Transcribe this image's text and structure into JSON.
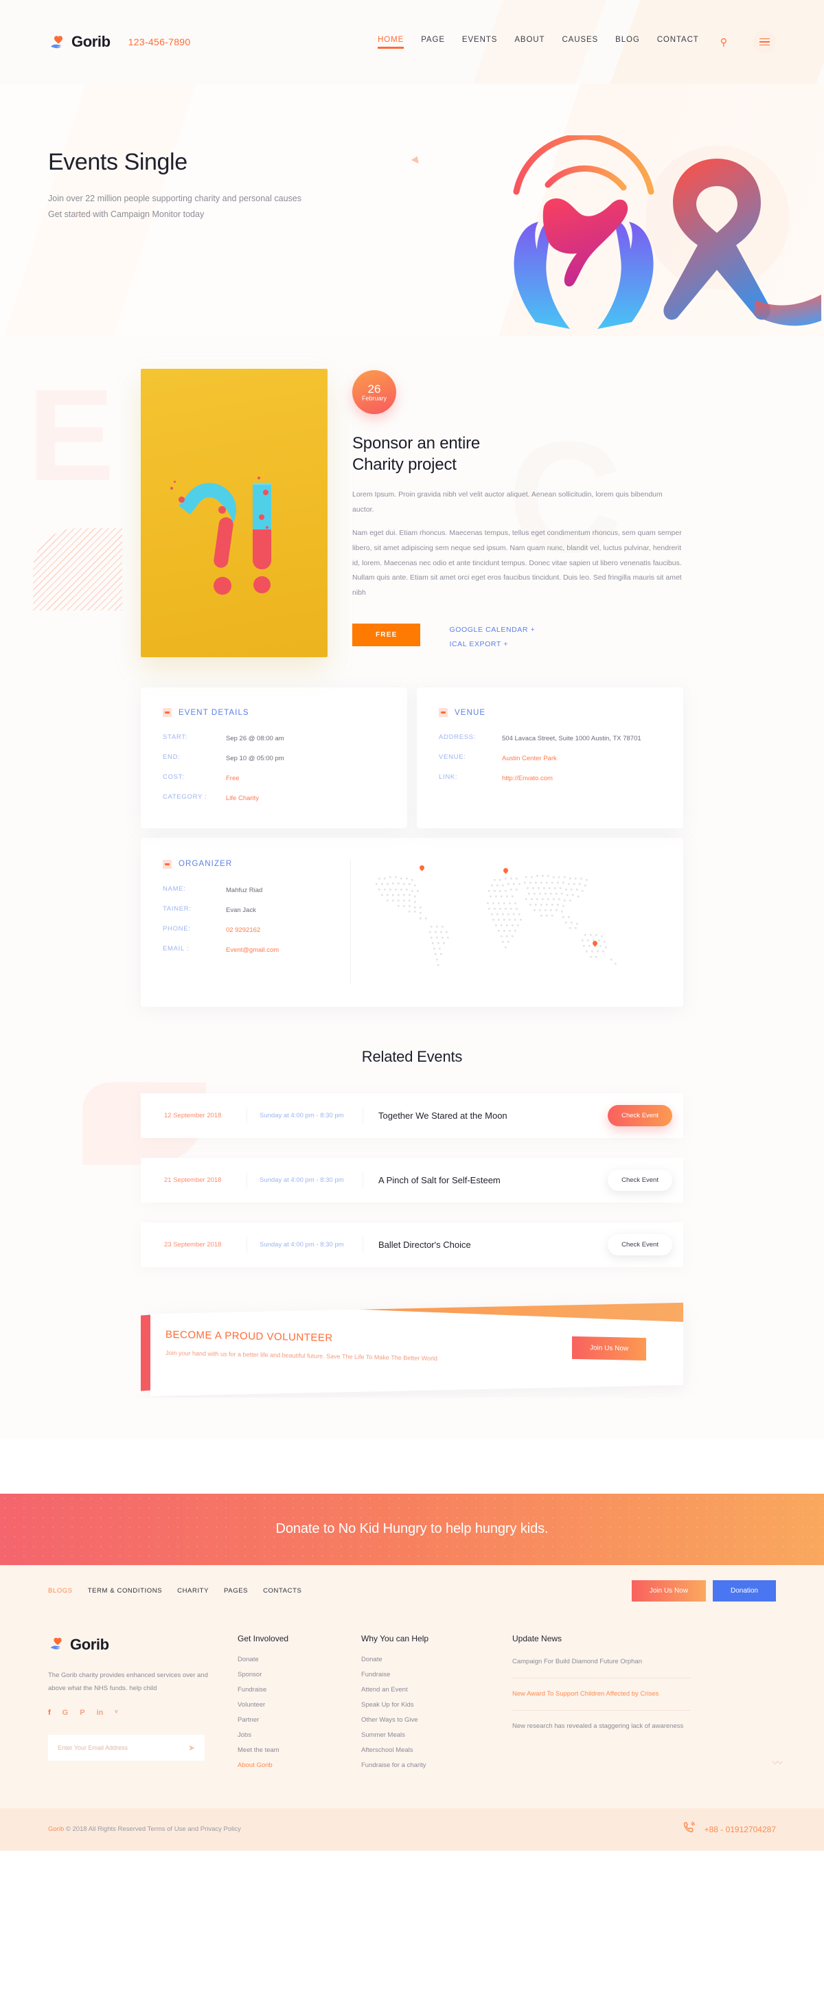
{
  "header": {
    "brand": "Gorib",
    "logo_icon": "heart-hand-icon",
    "phone": "123-456-7890",
    "nav": [
      {
        "label": "HOME",
        "active": true
      },
      {
        "label": "PAGE",
        "active": false
      },
      {
        "label": "EVENTS",
        "active": false
      },
      {
        "label": "ABOUT",
        "active": false
      },
      {
        "label": "CAUSES",
        "active": false
      },
      {
        "label": "BLOG",
        "active": false
      },
      {
        "label": "CONTACT",
        "active": false
      }
    ],
    "search_icon": "search-icon",
    "menu_icon": "hamburger-icon"
  },
  "hero": {
    "title": "Events Single",
    "subtitle_line1": "Join over 22 million people supporting charity and personal causes",
    "subtitle_line2": "Get started with Campaign Monitor today",
    "illustration": "hands-dove-ribbon-icon"
  },
  "event": {
    "image_alt": "question-exclamation-mark-photo",
    "date_day": "26",
    "date_month": "February",
    "title_line1": "Sponsor an entire",
    "title_line2": "Charity project",
    "paragraph1": "Lorem Ipsum. Proin gravida nibh vel velit auctor aliquet. Aenean sollicitudin, lorem quis bibendum auctor.",
    "paragraph2": "Nam eget dui. Etiam rhoncus. Maecenas tempus, tellus eget condimentum rhoncus, sem quam semper libero, sit amet adipiscing sem neque sed ipsum. Nam quam nunc, blandit vel, luctus pulvinar, hendrerit id, lorem. Maecenas nec odio et ante tincidunt tempus. Donec vitae sapien ut libero venenatis faucibus. Nullam quis ante. Etiam sit amet orci eget eros faucibus tincidunt. Duis leo. Sed fringilla mauris sit amet nibh",
    "price_button": "FREE",
    "google_calendar": "GOOGLE CALENDAR +",
    "ical_export": "ICAL EXPORT +"
  },
  "event_details": {
    "title": "EVENT DETAILS",
    "rows": [
      {
        "label": "START:",
        "value": "Sep 26 @ 08:00 am",
        "accent": false
      },
      {
        "label": "END:",
        "value": "Sep 10 @ 05:00 pm",
        "accent": false
      },
      {
        "label": "COST:",
        "value": "Free",
        "accent": true
      },
      {
        "label": "CATEGORY :",
        "value": "Life Charity",
        "accent": true
      }
    ]
  },
  "venue": {
    "title": "VENUE",
    "rows": [
      {
        "label": "ADDRESS:",
        "value": "504 Lavaca Street, Suite 1000 Austin, TX 78701",
        "accent": false
      },
      {
        "label": "VENUE:",
        "value": "Austin Center Park",
        "accent": true
      },
      {
        "label": "LINK:",
        "value": "http://Envato.com",
        "accent": true
      }
    ]
  },
  "organizer": {
    "title": "ORGANIZER",
    "rows": [
      {
        "label": "NAME:",
        "value": "Mahfuz Riad",
        "accent": false
      },
      {
        "label": "TAINER:",
        "value": "Evan Jack",
        "accent": false
      },
      {
        "label": "PHONE:",
        "value": "02 9292162",
        "accent": true
      },
      {
        "label": "EMAIL :",
        "value": "Event@gmail.com",
        "accent": true
      }
    ],
    "map_icon": "world-map-icon"
  },
  "related": {
    "title": "Related Events",
    "items": [
      {
        "date": "12 September 2018",
        "time": "Sunday at 4:00 pm - 8:30 pm",
        "name": "Together We Stared at the Moon",
        "button": "Check Event",
        "primary": true
      },
      {
        "date": "21 September 2018",
        "time": "Sunday at 4:00 pm - 8:30 pm",
        "name": "A Pinch of Salt for Self-Esteem",
        "button": "Check Event",
        "primary": false
      },
      {
        "date": "23 September 2018",
        "time": "Sunday at 4:00 pm - 8:30 pm",
        "name": "Ballet Director's Choice",
        "button": "Check Event",
        "primary": false
      }
    ]
  },
  "volunteer": {
    "title": "BECOME A PROUD VOLUNTEER",
    "subtitle": "Join your hand with us for a better life and beautiful future. Save The Life To Make The Better World",
    "button": "Join Us Now"
  },
  "donate_banner": {
    "text": "Donate to No Kid Hungry to help hungry kids."
  },
  "footer": {
    "links": [
      {
        "label": "BLOGS",
        "active": true
      },
      {
        "label": "TERM & CONDITIONS",
        "active": false
      },
      {
        "label": "CHARITY",
        "active": false
      },
      {
        "label": "PAGES",
        "active": false
      },
      {
        "label": "CONTACTS",
        "active": false
      }
    ],
    "join_button": "Join Us Now",
    "donation_button": "Donation",
    "brand": "Gorib",
    "description": "The Gorib charity provides enhanced services over and above what the NHS funds. help child",
    "social": [
      {
        "icon": "facebook-icon",
        "glyph": "f"
      },
      {
        "icon": "google-plus-icon",
        "glyph": "G"
      },
      {
        "icon": "pinterest-icon",
        "glyph": "P"
      },
      {
        "icon": "linkedin-icon",
        "glyph": "in"
      },
      {
        "icon": "twitter-icon",
        "glyph": "ᵛ"
      }
    ],
    "newsletter_placeholder": "Enter Your Email Address",
    "send_icon": "send-plane-icon",
    "col_get_involved": {
      "heading": "Get Involoved",
      "items": [
        {
          "label": "Donate",
          "accent": false
        },
        {
          "label": "Sponsor",
          "accent": false
        },
        {
          "label": "Fundraise",
          "accent": false
        },
        {
          "label": "Volunteer",
          "accent": false
        },
        {
          "label": "Partner",
          "accent": false
        },
        {
          "label": "Jobs",
          "accent": false
        },
        {
          "label": "Meet the team",
          "accent": false
        },
        {
          "label": "About Gorib",
          "accent": true
        }
      ]
    },
    "col_why_help": {
      "heading": "Why You can Help",
      "items": [
        {
          "label": "Donate",
          "accent": false
        },
        {
          "label": "Fundraise",
          "accent": false
        },
        {
          "label": "Attend an Event",
          "accent": false
        },
        {
          "label": "Speak Up for Kids",
          "accent": false
        },
        {
          "label": "Other Ways to Give",
          "accent": false
        },
        {
          "label": "Summer Meals",
          "accent": false
        },
        {
          "label": "Afterschool Meals",
          "accent": false
        },
        {
          "label": "Fundraise for a charity",
          "accent": false
        }
      ]
    },
    "col_news": {
      "heading": "Update News",
      "items": [
        {
          "text": "Campaign For Build Diamond Future Orphan",
          "accent": false
        },
        {
          "text": "New Award To Support Children Affected by Crises",
          "accent": true
        },
        {
          "text": "New research has revealed a staggering lack of awareness",
          "accent": false
        }
      ]
    },
    "copyright_brand": "Gorib",
    "copyright": "© 2018 All Rights Reserved Terms of Use and Privacy Policy",
    "phone_icon": "phone-ring-icon",
    "phone": "+88 - 01912704287"
  },
  "colors": {
    "accent_orange": "#ff6b35",
    "accent_red": "#f75a5f",
    "accent_blue": "#5b7fe8",
    "blue_button": "#4a76f2",
    "yellow_image": "#f0bb26",
    "footer_bg": "#fdf4ec"
  }
}
